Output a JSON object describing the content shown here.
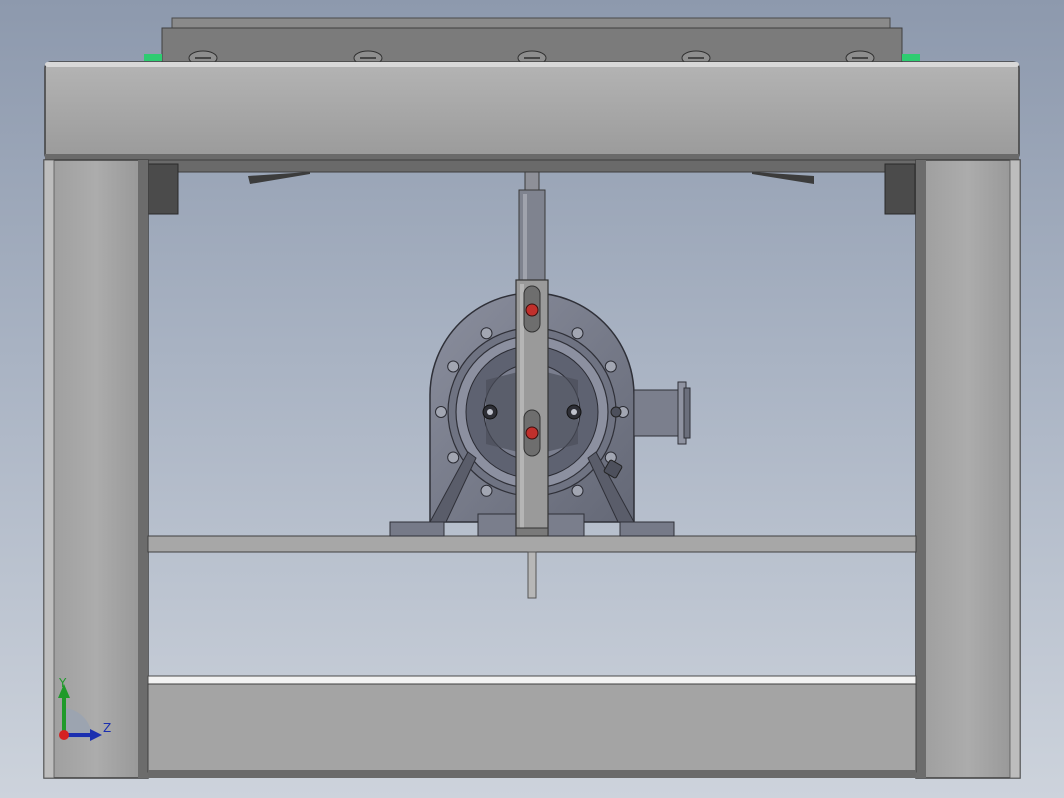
{
  "viewport": {
    "background_top": "#8d99ad",
    "background_bottom": "#cdd3dc"
  },
  "colors": {
    "frame_face": "#a6a6a6",
    "frame_edge": "#6e6e6e",
    "frame_dark": "#4e4e4e",
    "motor_body": "#7d8190",
    "motor_dark": "#575a67",
    "slider_plate": "#909090",
    "marker_red": "#c0302c",
    "accent_green": "#2ecc71"
  },
  "triad": {
    "y_label": "Y",
    "z_label": "Z",
    "y_color": "#1f9a2a",
    "z_color": "#1b2fb0",
    "origin_color": "#d42222"
  },
  "parts": {
    "top_screws": [
      "screw",
      "screw",
      "screw",
      "screw",
      "screw"
    ],
    "flange_holes": [
      "hole",
      "hole",
      "hole",
      "hole",
      "hole",
      "hole",
      "hole",
      "hole",
      "hole",
      "hole",
      "hole",
      "hole"
    ],
    "slider_pins": [
      "upper-pin",
      "lower-pin"
    ]
  }
}
